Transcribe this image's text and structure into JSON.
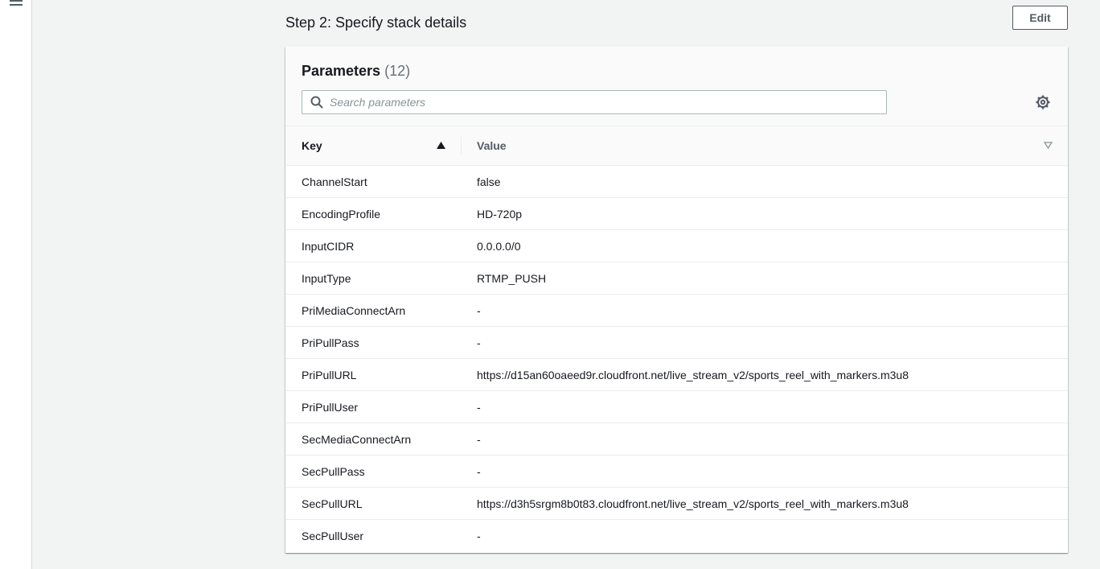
{
  "nav": {
    "menu_icon": "hamburger-menu-icon"
  },
  "step": {
    "title": "Step 2: Specify stack details",
    "edit_label": "Edit"
  },
  "parameters": {
    "title": "Parameters",
    "count": "(12)",
    "search_placeholder": "Search parameters",
    "search_value": "",
    "settings_icon": "gear-icon",
    "columns": {
      "key": "Key",
      "value": "Value",
      "key_sort": "ascending",
      "value_sort": "none"
    },
    "rows": [
      {
        "key": "ChannelStart",
        "value": "false"
      },
      {
        "key": "EncodingProfile",
        "value": "HD-720p"
      },
      {
        "key": "InputCIDR",
        "value": "0.0.0.0/0"
      },
      {
        "key": "InputType",
        "value": "RTMP_PUSH"
      },
      {
        "key": "PriMediaConnectArn",
        "value": "-"
      },
      {
        "key": "PriPullPass",
        "value": "-"
      },
      {
        "key": "PriPullURL",
        "value": "https://d15an60oaeed9r.cloudfront.net/live_stream_v2/sports_reel_with_markers.m3u8"
      },
      {
        "key": "PriPullUser",
        "value": "-"
      },
      {
        "key": "SecMediaConnectArn",
        "value": "-"
      },
      {
        "key": "SecPullPass",
        "value": "-"
      },
      {
        "key": "SecPullURL",
        "value": "https://d3h5srgm8b0t83.cloudfront.net/live_stream_v2/sports_reel_with_markers.m3u8"
      },
      {
        "key": "SecPullUser",
        "value": "-"
      }
    ]
  },
  "colors": {
    "background": "#f2f3f3",
    "panel": "#ffffff",
    "header": "#fafafa",
    "text": "#16191f",
    "muted": "#687078",
    "border": "#eaeded"
  }
}
